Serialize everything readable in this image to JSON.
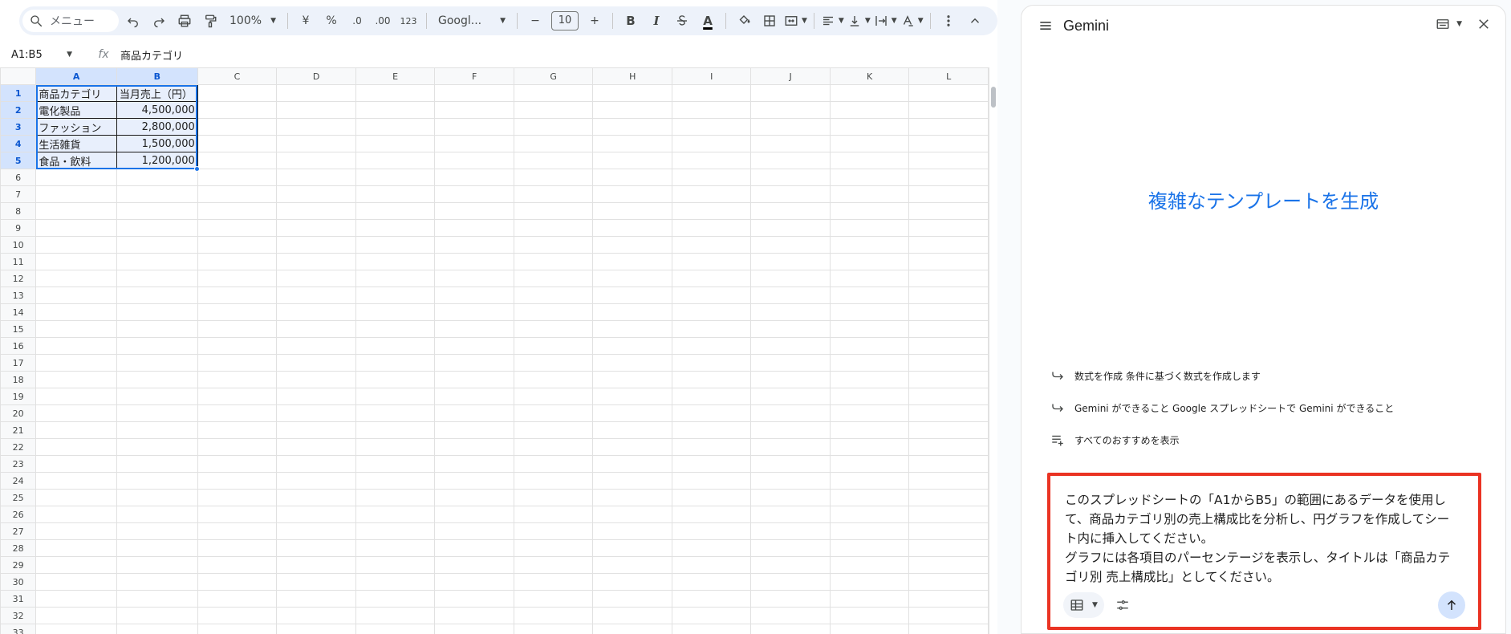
{
  "toolbar": {
    "search_label": "メニュー",
    "zoom": "100%",
    "currency": "¥",
    "percent": "%",
    "decimal_decrease": ".0",
    "decimal_increase": ".00",
    "number_format": "123",
    "font": "Googl...",
    "font_size": "10",
    "bold": "B",
    "italic": "I",
    "text_color": "A"
  },
  "formula_bar": {
    "name_box": "A1:B5",
    "fx": "fx",
    "content": "商品カテゴリ"
  },
  "sheet": {
    "columns": [
      "A",
      "B",
      "C",
      "D",
      "E",
      "F",
      "G",
      "H",
      "I",
      "J",
      "K",
      "L"
    ],
    "rows": [
      "1",
      "2",
      "3",
      "4",
      "5",
      "6",
      "7",
      "8",
      "9",
      "10",
      "11",
      "12",
      "13",
      "14",
      "15",
      "16",
      "17",
      "18",
      "19",
      "20",
      "21",
      "22",
      "23",
      "24",
      "25",
      "26",
      "27",
      "28",
      "29",
      "30",
      "31",
      "32",
      "33"
    ],
    "cells": [
      [
        "商品カテゴリ",
        "当月売上（円）"
      ],
      [
        "電化製品",
        "4,500,000"
      ],
      [
        "ファッション",
        "2,800,000"
      ],
      [
        "生活雑貨",
        "1,500,000"
      ],
      [
        "食品・飲料",
        "1,200,000"
      ]
    ]
  },
  "gemini": {
    "title": "Gemini",
    "hero": "複雑なテンプレートを生成",
    "suggestions": [
      "数式を作成 条件に基づく数式を作成します",
      "Gemini ができること Google スプレッドシートで Gemini ができること",
      "すべてのおすすめを表示"
    ],
    "prompt": "このスプレッドシートの「A1からB5」の範囲にあるデータを使用し\nて、商品カテゴリ別の売上構成比を分析し、円グラフを作成してシー\nト内に挿入してください。\nグラフには各項目のパーセンテージを表示し、タイトルは「商品カテ\nゴリ別 売上構成比」としてください。"
  },
  "colors": {
    "accent": "#1a73e8",
    "highlight_border": "#ea3323",
    "selection_header": "#d3e3fd"
  }
}
